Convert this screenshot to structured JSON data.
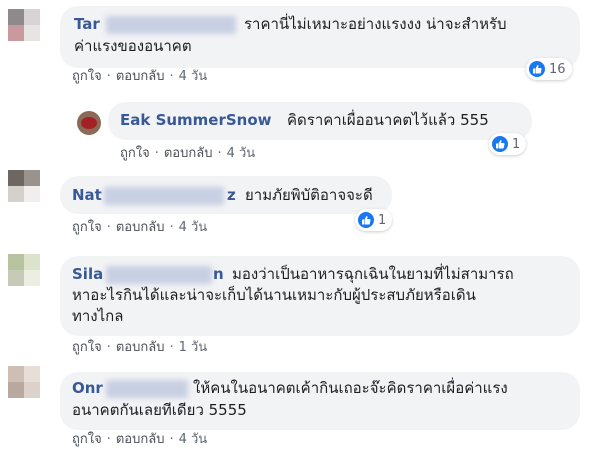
{
  "comments": [
    {
      "name_visible": "Tar",
      "text": [
        "ราคานี่ไม่เหมาะอย่างแรงงง น่าจะสำหรับ",
        "ค่าแรงของอนาคต"
      ],
      "like_label": "ถูกใจ",
      "reply_label": "ตอบกลับ",
      "time": "4 วัน",
      "reaction_count": "16"
    },
    {
      "name_visible": "Eak SummerSnow",
      "text": [
        "คิดราคาเผื่ออนาคตไว้แล้ว 555"
      ],
      "like_label": "ถูกใจ",
      "reply_label": "ตอบกลับ",
      "time": "4 วัน",
      "reaction_count": "1"
    },
    {
      "name_visible": "Nat",
      "name_suffix": "z",
      "text": [
        "ยามภัยพิบัติอาจจะดี"
      ],
      "like_label": "ถูกใจ",
      "reply_label": "ตอบกลับ",
      "time": "4 วัน",
      "reaction_count": "1"
    },
    {
      "name_visible": "Sila",
      "name_suffix": "n",
      "text": [
        "มองว่าเป็นอาหารฉุกเฉินในยามที่ไม่สามารถ",
        "หาอะไรกินได้และน่าจะเก็บได้นานเหมาะกับผู้ประสบภัยหรือเดิน",
        "ทางไกล"
      ],
      "like_label": "ถูกใจ",
      "reply_label": "ตอบกลับ",
      "time": "1 วัน"
    },
    {
      "name_visible": "Onr",
      "text": [
        "ให้คนในอนาคตเค้ากินเถอะจ๊ะคิดราคาเผื่อค่าแรง",
        "อนาคตกันเลยทีเดียว 5555"
      ],
      "like_label": "ถูกใจ",
      "reply_label": "ตอบกลับ",
      "time": "4 วัน"
    }
  ],
  "separator": "·",
  "icons": {
    "reaction": "like-icon"
  },
  "colors": {
    "name": "#385898",
    "bubble": "#f2f3f5",
    "like": "#1877f2"
  }
}
